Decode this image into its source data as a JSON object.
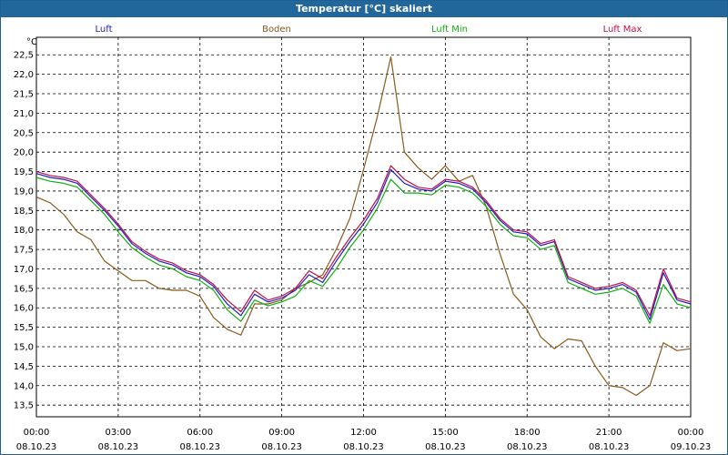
{
  "window": {
    "title": "Temperatur [°C] skaliert"
  },
  "chart_data": {
    "type": "line",
    "title": "Temperatur [°C] skaliert",
    "ylabel": "°C",
    "xlabel": "",
    "ylim": [
      13.2,
      22.95
    ],
    "xlim": [
      0,
      24
    ],
    "grid": true,
    "legend_position": "top",
    "yticks": [
      13.5,
      14.0,
      14.5,
      15.0,
      15.5,
      16.0,
      16.5,
      17.0,
      17.5,
      18.0,
      18.5,
      19.0,
      19.5,
      20.0,
      20.5,
      21.0,
      21.5,
      22.0,
      22.5
    ],
    "ytick_labels": [
      "13,5",
      "14,0",
      "14,5",
      "15,0",
      "15,5",
      "16,0",
      "16,5",
      "17,0",
      "17,5",
      "18,0",
      "18,5",
      "19,0",
      "19,5",
      "20,0",
      "20,5",
      "21,0",
      "21,5",
      "22,0",
      "22,5"
    ],
    "xticks": [
      {
        "x": 0,
        "time": "00:00",
        "date": "08.10.23"
      },
      {
        "x": 3,
        "time": "03:00",
        "date": "08.10.23"
      },
      {
        "x": 6,
        "time": "06:00",
        "date": "08.10.23"
      },
      {
        "x": 9,
        "time": "09:00",
        "date": "08.10.23"
      },
      {
        "x": 12,
        "time": "12:00",
        "date": "08.10.23"
      },
      {
        "x": 15,
        "time": "15:00",
        "date": "08.10.23"
      },
      {
        "x": 18,
        "time": "18:00",
        "date": "08.10.23"
      },
      {
        "x": 21,
        "time": "21:00",
        "date": "08.10.23"
      },
      {
        "x": 24,
        "time": "00:00",
        "date": "09.10.23"
      }
    ],
    "x": [
      0,
      0.5,
      1,
      1.5,
      2,
      2.5,
      3,
      3.5,
      4,
      4.5,
      5,
      5.5,
      6,
      6.5,
      7,
      7.5,
      8,
      8.5,
      9,
      9.5,
      10,
      10.5,
      11,
      11.5,
      12,
      12.5,
      13,
      13.5,
      14,
      14.5,
      15,
      15.5,
      16,
      16.5,
      17,
      17.5,
      18,
      18.5,
      19,
      19.5,
      20,
      20.5,
      21,
      21.5,
      22,
      22.5,
      23,
      23.5,
      24
    ],
    "series": [
      {
        "name": "Luft",
        "color": "#2020c0",
        "values": [
          19.45,
          19.35,
          19.3,
          19.2,
          18.85,
          18.5,
          18.1,
          17.65,
          17.4,
          17.2,
          17.1,
          16.9,
          16.8,
          16.55,
          16.1,
          15.8,
          16.35,
          16.15,
          16.25,
          16.45,
          16.85,
          16.65,
          17.2,
          17.7,
          18.15,
          18.7,
          19.55,
          19.2,
          19.05,
          19.0,
          19.25,
          19.2,
          19.05,
          18.7,
          18.25,
          17.95,
          17.9,
          17.6,
          17.7,
          16.75,
          16.6,
          16.45,
          16.5,
          16.6,
          16.4,
          15.7,
          16.9,
          16.2,
          16.1
        ]
      },
      {
        "name": "Boden",
        "color": "#8a5a1e",
        "values": [
          18.85,
          18.7,
          18.4,
          17.95,
          17.75,
          17.2,
          16.95,
          16.7,
          16.7,
          16.5,
          16.45,
          16.45,
          16.3,
          15.75,
          15.45,
          15.3,
          16.1,
          16.1,
          16.2,
          16.5,
          16.65,
          16.85,
          17.5,
          18.3,
          19.55,
          20.9,
          22.45,
          20.0,
          19.6,
          19.3,
          19.65,
          19.25,
          19.4,
          18.6,
          17.4,
          16.35,
          15.95,
          15.25,
          14.95,
          15.2,
          15.15,
          14.5,
          14.0,
          13.95,
          13.75,
          14.0,
          15.1,
          14.9,
          14.95
        ]
      },
      {
        "name": "Luft Min",
        "color": "#10b010",
        "values": [
          19.35,
          19.25,
          19.2,
          19.1,
          18.75,
          18.4,
          17.95,
          17.55,
          17.3,
          17.1,
          17.0,
          16.8,
          16.7,
          16.45,
          15.95,
          15.65,
          16.2,
          16.05,
          16.15,
          16.3,
          16.7,
          16.55,
          17.0,
          17.55,
          18.0,
          18.55,
          19.3,
          18.95,
          18.95,
          18.9,
          19.15,
          19.1,
          18.95,
          18.6,
          18.15,
          17.85,
          17.8,
          17.5,
          17.6,
          16.65,
          16.5,
          16.35,
          16.4,
          16.5,
          16.3,
          15.6,
          16.6,
          16.1,
          16.0
        ]
      },
      {
        "name": "Luft Max",
        "color": "#c01040",
        "values": [
          19.5,
          19.4,
          19.35,
          19.25,
          18.9,
          18.55,
          18.15,
          17.7,
          17.45,
          17.25,
          17.15,
          16.95,
          16.85,
          16.6,
          16.2,
          15.9,
          16.45,
          16.2,
          16.3,
          16.5,
          16.95,
          16.75,
          17.3,
          17.8,
          18.25,
          18.8,
          19.65,
          19.3,
          19.1,
          19.05,
          19.3,
          19.25,
          19.1,
          18.75,
          18.3,
          18.0,
          17.95,
          17.65,
          17.75,
          16.8,
          16.65,
          16.5,
          16.55,
          16.65,
          16.45,
          15.8,
          17.0,
          16.25,
          16.15
        ]
      }
    ]
  }
}
